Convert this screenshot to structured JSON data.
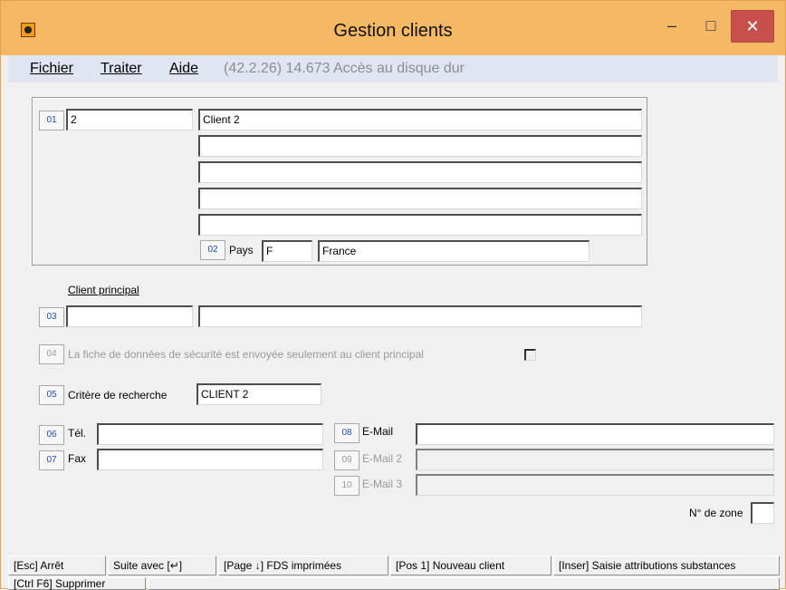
{
  "window": {
    "title": "Gestion clients",
    "controls": {
      "minimize": "–",
      "maximize": "□",
      "close": "✕"
    }
  },
  "menu": {
    "items": [
      {
        "label": "Fichier"
      },
      {
        "label": "Traiter"
      },
      {
        "label": "Aide"
      }
    ],
    "status": "(42.2.26) 14.673 Accès au disque dur"
  },
  "address": {
    "btn01": "01",
    "number": "2",
    "lines": [
      "Client 2",
      "",
      "",
      "",
      ""
    ],
    "btn02": "02",
    "pays_label": "Pays",
    "country_code": "F",
    "country_name": "France"
  },
  "principal": {
    "heading": "Client principal",
    "btn03": "03",
    "code": "",
    "name": ""
  },
  "safety": {
    "btn04": "04",
    "label": "La fiche de données de sécurité est envoyée seulement au client principal",
    "checked": false
  },
  "search": {
    "btn05": "05",
    "label": "Critère de recherche",
    "value": "CLIENT 2"
  },
  "contact": {
    "btn06": "06",
    "tel_label": "Tél.",
    "tel": "",
    "btn07": "07",
    "fax_label": "Fax",
    "fax": "",
    "btn08": "08",
    "email_label": "E-Mail",
    "email": "",
    "btn09": "09",
    "email2_label": "E-Mail 2",
    "email2": "",
    "btn10": "10",
    "email3_label": "E-Mail 3",
    "email3": ""
  },
  "zone": {
    "label": "N° de zone",
    "value": ""
  },
  "statusbar": {
    "esc": "[Esc] Arrêt",
    "suite": "Suite avec [↵]",
    "page": "[Page ↓] FDS imprimées",
    "pos": "[Pos 1] Nouveau client",
    "inser": "[Inser] Saisie attributions substances",
    "ctrl": "[Ctrl F6] Supprimer"
  },
  "colors": {
    "titlebar": "#f5b865",
    "menubar": "#dfe5f1",
    "close": "#c7504b",
    "num_button_text": "#1f4fb5"
  }
}
